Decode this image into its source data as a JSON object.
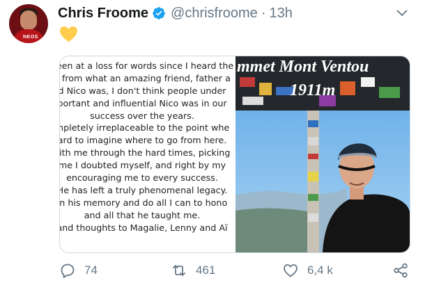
{
  "tweet": {
    "author_name": "Chris Froome",
    "handle": "@chrisfroome",
    "separator": "·",
    "timestamp": "13h",
    "avatar_logo": "NEOS",
    "emoji": "yellow-heart"
  },
  "media": {
    "letter_lines": [
      "been at a loss for words since I heard the",
      "e from what an amazing friend, father a",
      "d Nico was, I don't think people under",
      "portant and influential Nico was in our",
      "success over the years.",
      "mpletely irreplaceable to the point whe",
      "ard to imagine where to go from here.",
      "vith me through the hard times, picking",
      "me I doubted myself, and right by my",
      "encouraging me to every success.",
      "He has left a truly phenomenal legacy.",
      "in his memory and do all I can to hono",
      "and all that he taught me.",
      "and thoughts to Magalie, Lenny and Aï"
    ],
    "sign_text": "mmet Mont Ventou",
    "sign_year": "1911m"
  },
  "actions": {
    "reply_count": "74",
    "retweet_count": "461",
    "like_count": "6,4 k"
  },
  "colors": {
    "verified": "#1da1f2",
    "muted": "#657786",
    "emoji": "#ffcc4d"
  }
}
